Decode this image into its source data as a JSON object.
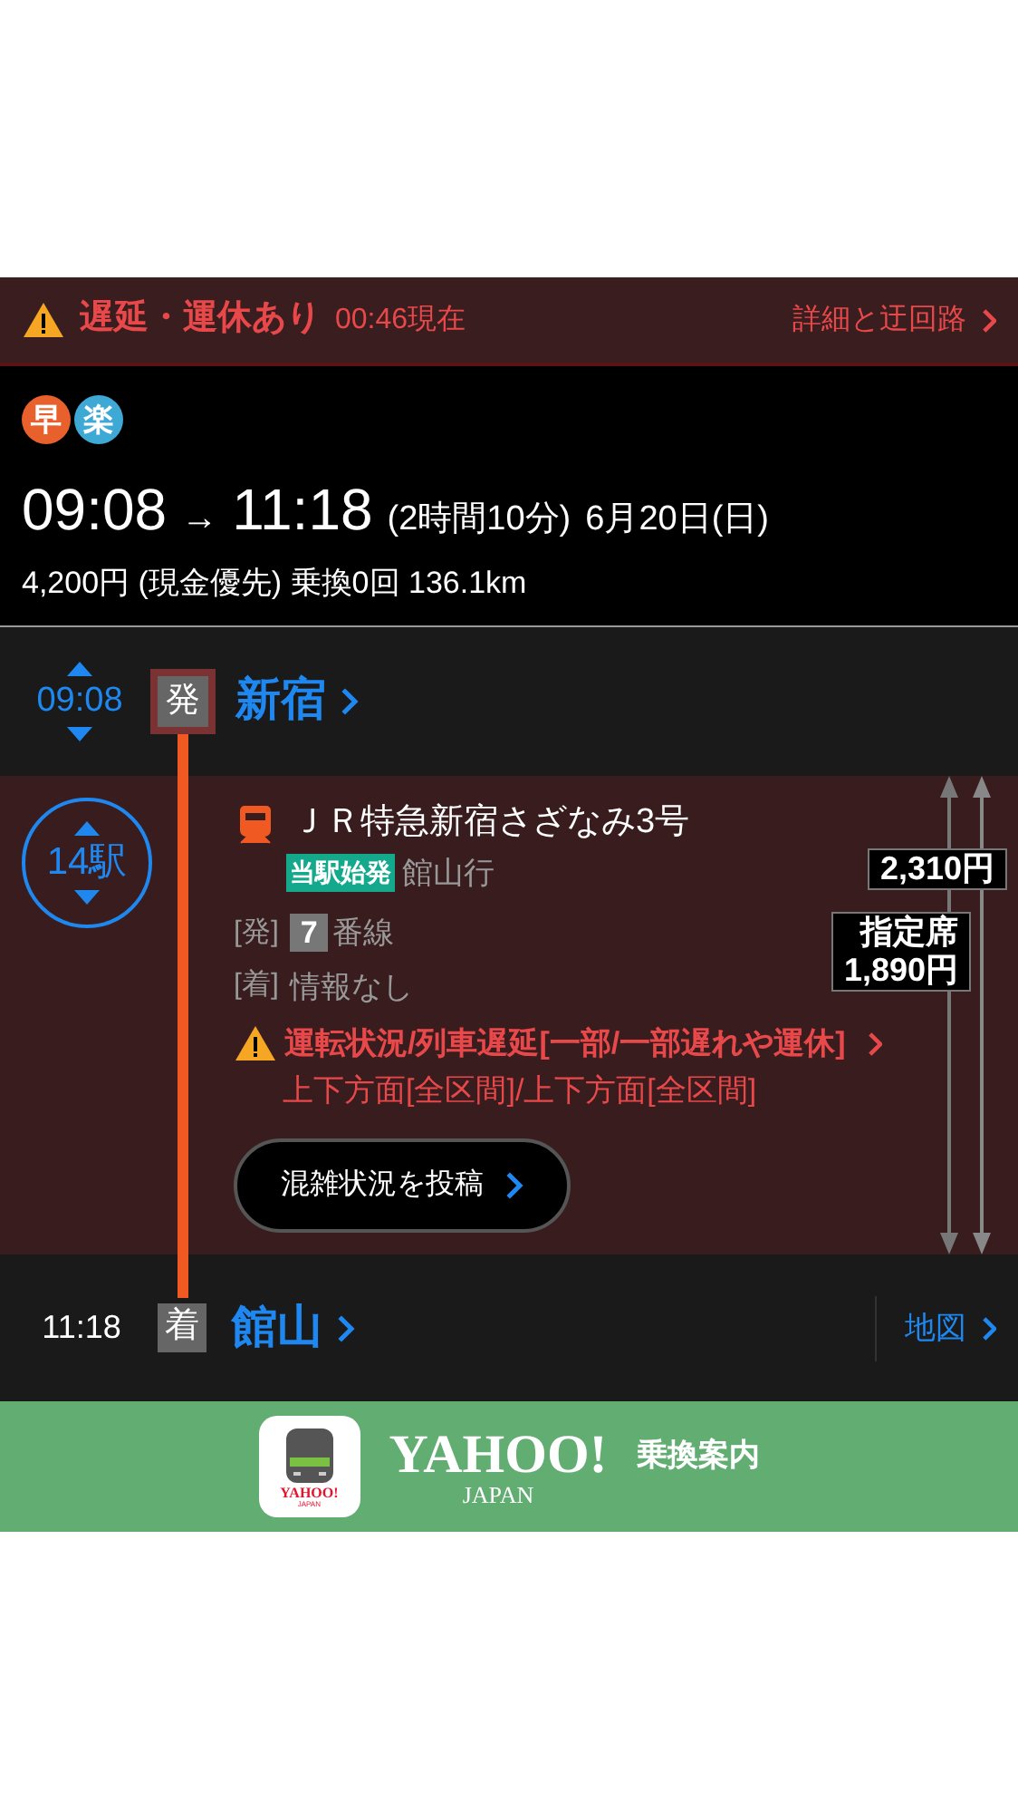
{
  "alert": {
    "title": "遅延・運休あり",
    "time": "00:46現在",
    "link": "詳細と迂回路"
  },
  "badges": [
    {
      "text": "早",
      "color": "#e8612c"
    },
    {
      "text": "楽",
      "color": "#3fa9d6"
    }
  ],
  "summary": {
    "depart": "09:08",
    "arrow": "→",
    "arrive": "11:18",
    "duration": "(2時間10分)",
    "date": "6月20日(日)",
    "fare": "4,200円 (現金優先) 乗換0回 136.1km"
  },
  "departure": {
    "time": "09:08",
    "mark": "発",
    "station": "新宿"
  },
  "segment": {
    "stops": "14駅",
    "train": "ＪＲ特急新宿さざなみ3号",
    "origin_badge": "当駅始発",
    "destination": "館山行",
    "platform_label": "[発]",
    "platform_number": "7",
    "platform_suffix": "番線",
    "arrival_label": "[着]",
    "arrival_info": "情報なし",
    "notice_title": "運転状況/列車遅延[一部/一部遅れや運休]",
    "notice_detail": "上下方面[全区間]/上下方面[全区間]",
    "button": "混雑状況を投稿",
    "fares": [
      {
        "amount": "2,310円"
      },
      {
        "label": "指定席",
        "amount": "1,890円"
      }
    ]
  },
  "arrival": {
    "time": "11:18",
    "mark": "着",
    "station": "館山",
    "map": "地図"
  },
  "banner": {
    "logo": "YAHOO!",
    "sub": "JAPAN",
    "service": "乗換案内",
    "icon_logo": "YAHOO!",
    "icon_sub": "JAPAN"
  }
}
